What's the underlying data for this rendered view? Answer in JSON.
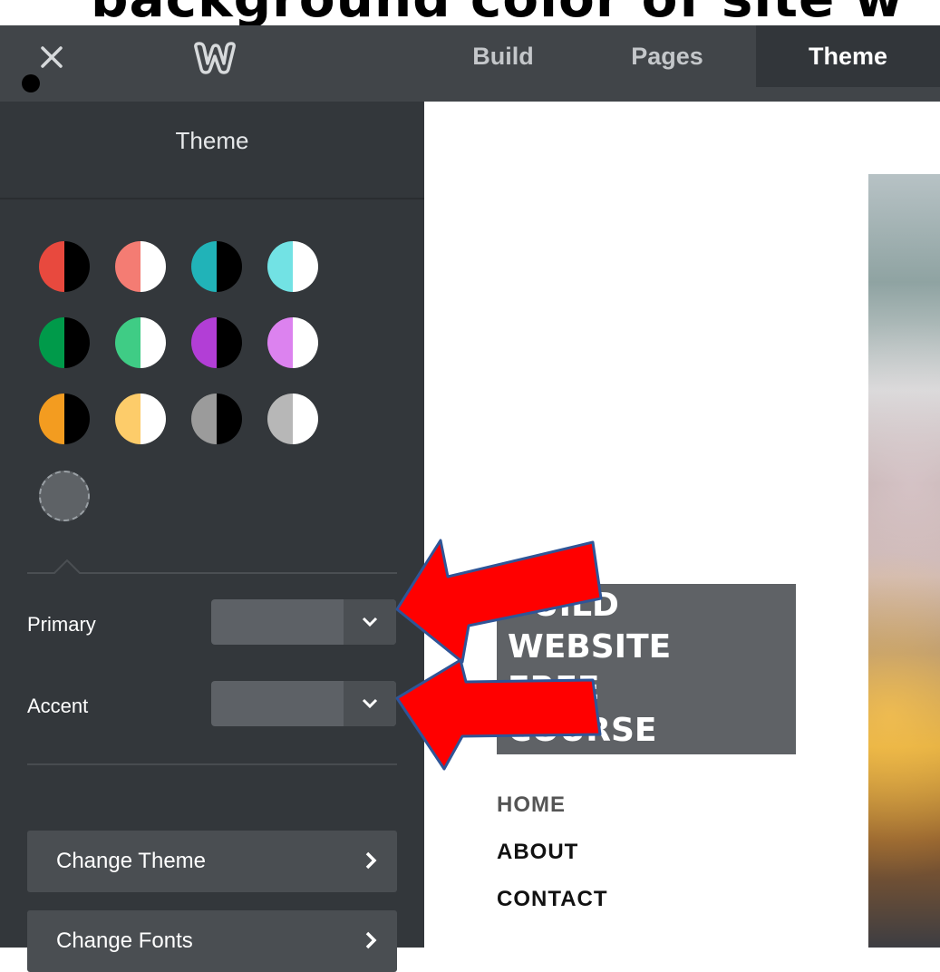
{
  "caption": "background color of site w",
  "topbar": {
    "tabs": [
      {
        "label": "Build"
      },
      {
        "label": "Pages"
      },
      {
        "label": "Theme"
      }
    ]
  },
  "sidebar": {
    "title": "Theme",
    "swatches": [
      {
        "left": "#e8493e",
        "right": "#000000"
      },
      {
        "left": "#f47c73",
        "right": "#ffffff"
      },
      {
        "left": "#21b3b8",
        "right": "#000000"
      },
      {
        "left": "#72e2e4",
        "right": "#ffffff"
      },
      {
        "left": "#009a4a",
        "right": "#000000"
      },
      {
        "left": "#3fcc85",
        "right": "#ffffff"
      },
      {
        "left": "#b23ed6",
        "right": "#000000"
      },
      {
        "left": "#dc82ef",
        "right": "#ffffff"
      },
      {
        "left": "#f39c20",
        "right": "#000000"
      },
      {
        "left": "#fdcc6a",
        "right": "#ffffff"
      },
      {
        "left": "#9b9b9b",
        "right": "#000000"
      },
      {
        "left": "#b7b7b7",
        "right": "#ffffff"
      }
    ],
    "primary_label": "Primary",
    "accent_label": "Accent",
    "change_theme_label": "Change Theme",
    "change_fonts_label": "Change Fonts"
  },
  "preview": {
    "title_lines": [
      "BUILD",
      "WEBSITE",
      "FREE",
      "COURSE"
    ],
    "nav": [
      "HOME",
      "ABOUT",
      "CONTACT"
    ],
    "nav_colors": [
      "#555555",
      "#111111",
      "#111111"
    ]
  },
  "annotation_color": "#ff0000"
}
